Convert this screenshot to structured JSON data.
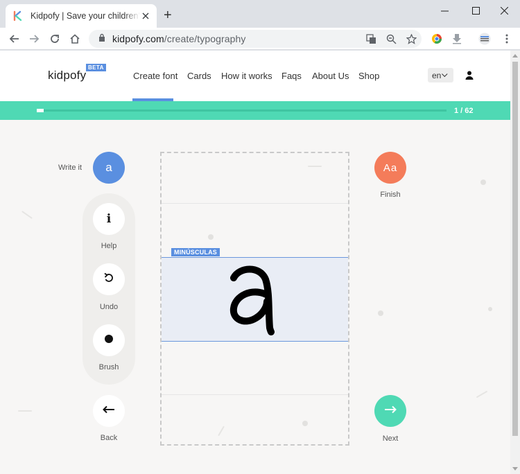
{
  "browser": {
    "tab_title": "Kidpofy | Save your children's drawings",
    "new_tab": "+",
    "url_host": "kidpofy.com",
    "url_path": "/create/typography"
  },
  "site": {
    "logo": "kidpofy",
    "beta": "BETA",
    "nav": [
      {
        "label": "Create font",
        "active": true
      },
      {
        "label": "Cards"
      },
      {
        "label": "How it works"
      },
      {
        "label": "Faqs"
      },
      {
        "label": "About Us"
      },
      {
        "label": "Shop"
      }
    ],
    "language": "en"
  },
  "progress": {
    "current": 1,
    "total": 62,
    "text": "1 / 62"
  },
  "editor": {
    "write_label": "Write it",
    "target_letter": "a",
    "case_label": "MINÚSCULAS",
    "tools": {
      "help": {
        "label": "Help",
        "glyph": "i"
      },
      "undo": {
        "label": "Undo"
      },
      "brush": {
        "label": "Brush"
      }
    },
    "back_label": "Back",
    "finish_label": "Finish",
    "finish_glyph": "Aa",
    "next_label": "Next"
  },
  "colors": {
    "accent_blue": "#5a8fe0",
    "progress_green": "#4fd9b4",
    "finish_orange": "#f47c5a"
  }
}
